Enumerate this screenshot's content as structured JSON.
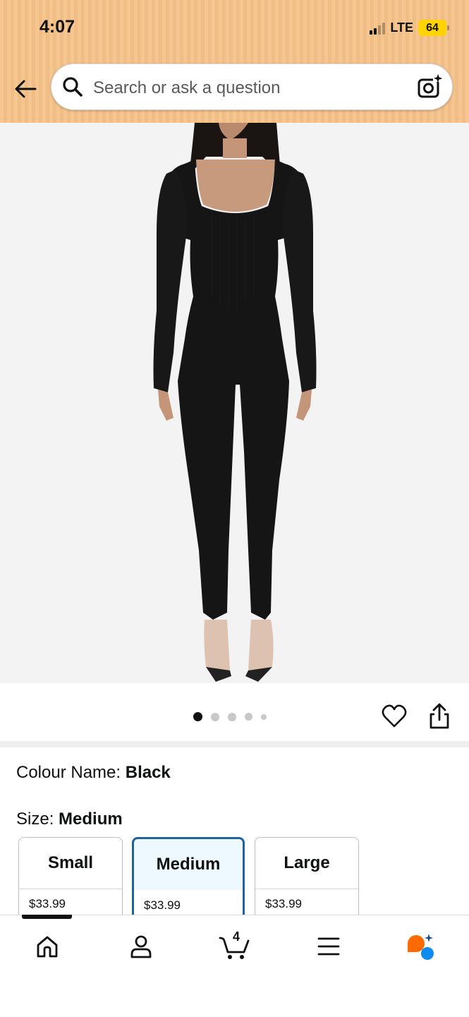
{
  "status_bar": {
    "time": "4:07",
    "network": "LTE",
    "battery": "64"
  },
  "search": {
    "placeholder": "Search or ask a question"
  },
  "gallery": {
    "image_count": 5,
    "active_index": 0
  },
  "product": {
    "colour_label": "Colour Name: ",
    "colour_value": "Black",
    "size_label": "Size: ",
    "size_value": "Medium"
  },
  "sizes": [
    {
      "name": "Small",
      "price": "$33.99",
      "selected": false
    },
    {
      "name": "Medium",
      "price": "$33.99",
      "selected": true
    },
    {
      "name": "Large",
      "price": "$33.99",
      "selected": false
    }
  ],
  "bottom_nav": {
    "items": [
      "home-icon",
      "account-icon",
      "cart-icon",
      "menu-icon",
      "rufus-icon"
    ],
    "cart_count": "4"
  },
  "colors": {
    "header_bg": "#f6c690",
    "selected_border": "#2162a1",
    "selected_bg": "#edf8ff",
    "battery": "#ffd400",
    "rufus_orange": "#ff6a00",
    "rufus_blue": "#0a8cf0"
  }
}
